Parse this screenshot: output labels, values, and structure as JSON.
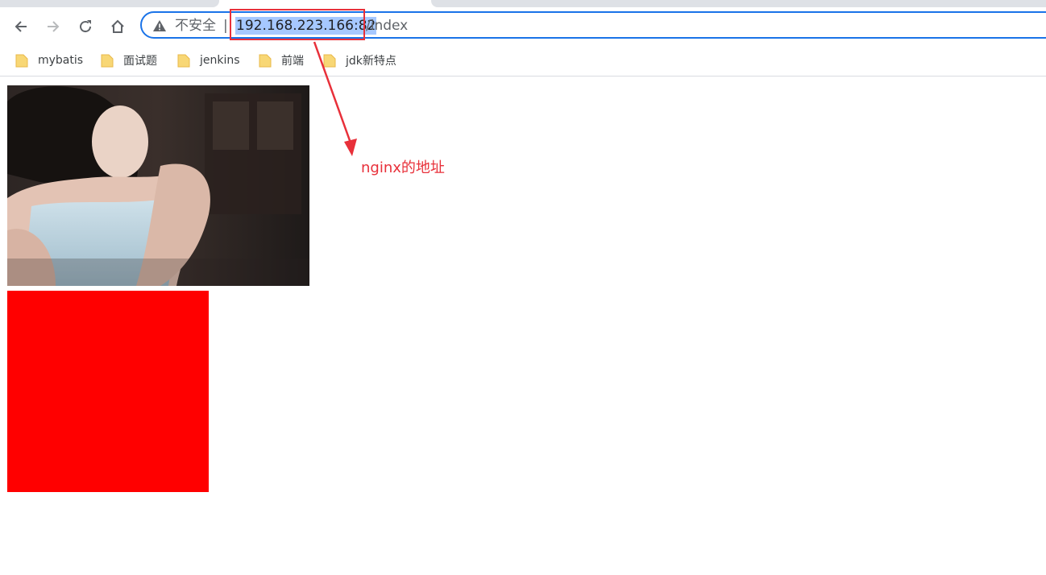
{
  "browser": {
    "security_label": "不安全",
    "separator": "|",
    "url_host": "192.168.223.166:82",
    "url_path": "/index",
    "accent_color": "#1a73e8"
  },
  "bookmarks": [
    {
      "label": "mybatis",
      "icon": "folder-icon"
    },
    {
      "label": "面试题",
      "icon": "folder-icon"
    },
    {
      "label": "jenkins",
      "icon": "folder-icon"
    },
    {
      "label": "前端",
      "icon": "folder-icon"
    },
    {
      "label": "jdk新特点",
      "icon": "folder-icon"
    }
  ],
  "page": {
    "red_box_color": "#ff0000"
  },
  "annotation": {
    "text": "nginx的地址",
    "color": "#e8303a"
  }
}
